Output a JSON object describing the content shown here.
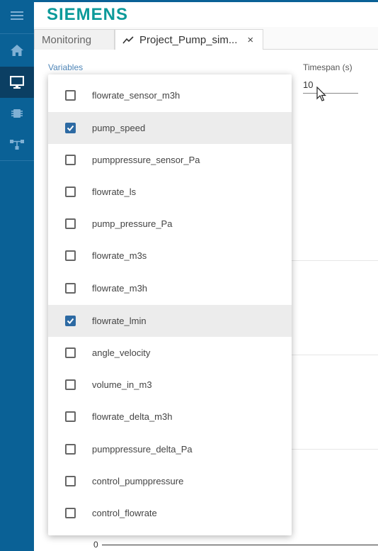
{
  "brand": {
    "logo_text": "SIEMENS",
    "logo_color": "#0b9a9a",
    "accent": "#0a6196"
  },
  "sidebar": {
    "items": [
      {
        "icon": "menu-icon"
      },
      {
        "icon": "home-icon"
      },
      {
        "icon": "monitor-icon",
        "active": true
      },
      {
        "icon": "chip-icon"
      },
      {
        "icon": "network-icon"
      }
    ]
  },
  "tabs": [
    {
      "label": "Monitoring"
    },
    {
      "label": "Project_Pump_sim...",
      "close": "×",
      "icon": "trend-icon"
    }
  ],
  "controls": {
    "variables_label": "Variables",
    "timespan_label": "Timespan (s)",
    "timespan_value": "10"
  },
  "chart": {
    "axis_zero": "0"
  },
  "variables": [
    {
      "label": "flowrate_sensor_m3h",
      "checked": false
    },
    {
      "label": "pump_speed",
      "checked": true
    },
    {
      "label": "pumppressure_sensor_Pa",
      "checked": false
    },
    {
      "label": "flowrate_ls",
      "checked": false
    },
    {
      "label": "pump_pressure_Pa",
      "checked": false
    },
    {
      "label": "flowrate_m3s",
      "checked": false
    },
    {
      "label": "flowrate_m3h",
      "checked": false
    },
    {
      "label": "flowrate_lmin",
      "checked": true
    },
    {
      "label": "angle_velocity",
      "checked": false
    },
    {
      "label": "volume_in_m3",
      "checked": false
    },
    {
      "label": "flowrate_delta_m3h",
      "checked": false
    },
    {
      "label": "pumppressure_delta_Pa",
      "checked": false
    },
    {
      "label": "control_pumppressure",
      "checked": false
    },
    {
      "label": "control_flowrate",
      "checked": false
    }
  ]
}
